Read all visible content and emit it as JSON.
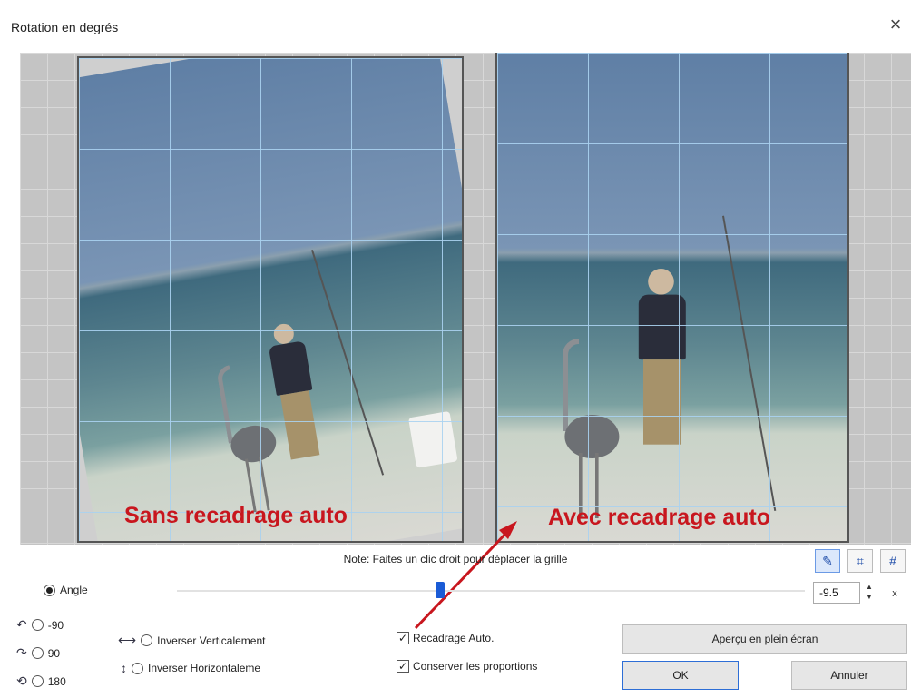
{
  "window": {
    "title": "Rotation en degrés",
    "close_icon": "close-icon"
  },
  "preview": {
    "left_label": "Sans recadrage auto",
    "right_label": "Avec recadrage auto",
    "label_color": "#c8161e"
  },
  "note": "Note: Faites un clic droit pour déplacer la grille",
  "angle": {
    "label": "Angle",
    "value": "-9.5",
    "x_label": "x"
  },
  "rotate_options": [
    {
      "icon": "rotate-left-icon",
      "label": "-90"
    },
    {
      "icon": "rotate-right-icon",
      "label": "90"
    },
    {
      "icon": "rotate-180-icon",
      "label": "180"
    }
  ],
  "flip_options": {
    "vertical": {
      "icon": "flip-horizontal-arrows-icon",
      "label": "Inverser Verticalement"
    },
    "horizontal": {
      "icon": "flip-vertical-arrows-icon",
      "label": "Inverser Horizontaleme"
    }
  },
  "checkboxes": {
    "auto_crop": {
      "label": "Recadrage Auto.",
      "checked": true
    },
    "keep_ratio": {
      "label": "Conserver les proportions",
      "checked": true
    }
  },
  "tools": [
    "pencil-icon",
    "crop-icon",
    "grid-icon"
  ],
  "buttons": {
    "fullscreen": "Aperçu en plein écran",
    "ok": "OK",
    "cancel": "Annuler"
  },
  "accent": "#1a5bd6"
}
